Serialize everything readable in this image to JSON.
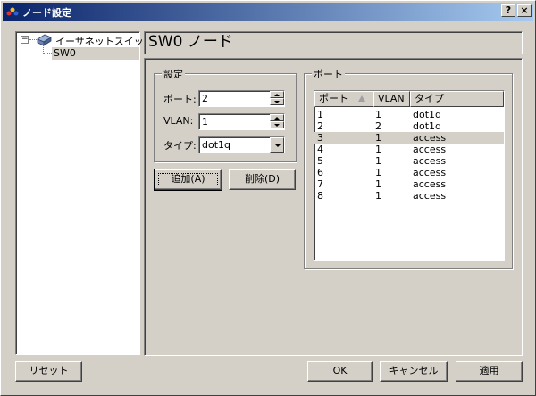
{
  "window": {
    "title": "ノード設定",
    "help_label": "?",
    "close_label": "×"
  },
  "tree": {
    "expander": "−",
    "root_label": "イーサネットスイッチ",
    "child_label": "SW0"
  },
  "header": {
    "title": "SW0 ノード"
  },
  "settings": {
    "group_title": "設定",
    "port_label": "ポート:",
    "port_value": "2",
    "vlan_label": "VLAN:",
    "vlan_value": "1",
    "type_label": "タイプ:",
    "type_value": "dot1q"
  },
  "actions": {
    "add_label": "追加(A)",
    "delete_label": "削除(D)"
  },
  "ports": {
    "group_title": "ポート",
    "columns": [
      "ポート",
      "VLAN",
      "タイプ"
    ],
    "rows": [
      {
        "port": "1",
        "vlan": "1",
        "type": "dot1q"
      },
      {
        "port": "2",
        "vlan": "2",
        "type": "dot1q"
      },
      {
        "port": "3",
        "vlan": "1",
        "type": "access"
      },
      {
        "port": "4",
        "vlan": "1",
        "type": "access"
      },
      {
        "port": "5",
        "vlan": "1",
        "type": "access"
      },
      {
        "port": "6",
        "vlan": "1",
        "type": "access"
      },
      {
        "port": "7",
        "vlan": "1",
        "type": "access"
      },
      {
        "port": "8",
        "vlan": "1",
        "type": "access"
      }
    ],
    "selected_row_index": 2
  },
  "footer": {
    "reset_label": "リセット",
    "ok_label": "OK",
    "cancel_label": "キャンセル",
    "apply_label": "適用"
  },
  "colors": {
    "titlebar_start": "#0a246a",
    "titlebar_end": "#a6caf0",
    "face": "#d4d0c8"
  }
}
